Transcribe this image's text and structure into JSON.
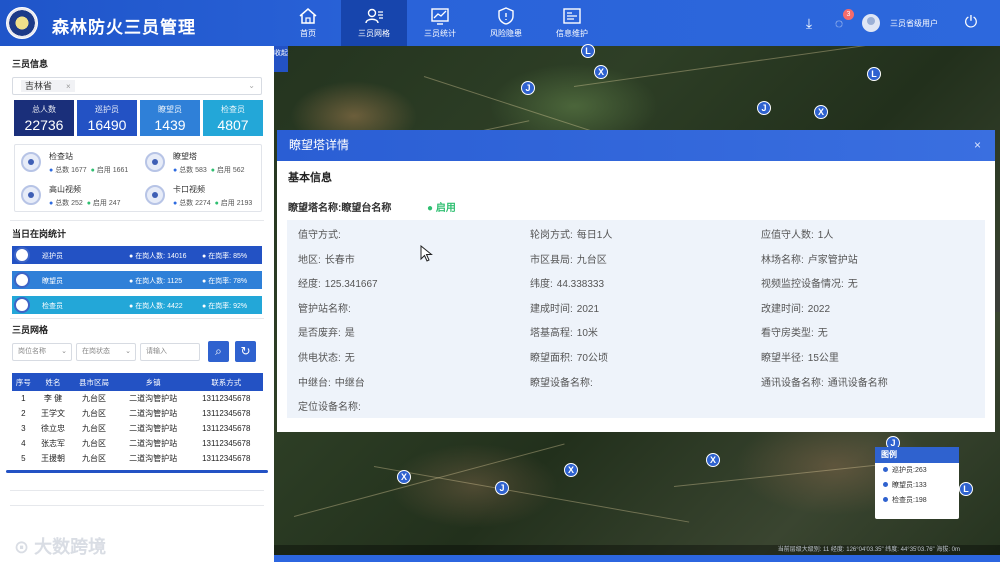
{
  "header": {
    "title": "森林防火三员管理",
    "nav": [
      {
        "label": "首页",
        "icon": "home-icon"
      },
      {
        "label": "三员网格",
        "icon": "users-icon",
        "active": true
      },
      {
        "label": "三员统计",
        "icon": "chart-icon"
      },
      {
        "label": "风险隐患",
        "icon": "shield-icon"
      },
      {
        "label": "信息维护",
        "icon": "id-card-icon"
      }
    ],
    "notification_count": "3",
    "user_name": "三员省级用户"
  },
  "left": {
    "info_title": "三员信息",
    "region_tag": "吉林省",
    "stats": [
      {
        "label": "总人数",
        "value": "22736",
        "color": "#1a2f7a"
      },
      {
        "label": "巡护员",
        "value": "16490",
        "color": "#2352c4"
      },
      {
        "label": "瞭望员",
        "value": "1439",
        "color": "#2f80d8"
      },
      {
        "label": "检查员",
        "value": "4807",
        "color": "#23a7d8"
      }
    ],
    "facilities": [
      {
        "name": "检查站",
        "total": "总数 1677",
        "enabled": "启用 1661"
      },
      {
        "name": "瞭望塔",
        "total": "总数 583",
        "enabled": "启用 562"
      },
      {
        "name": "高山视频",
        "total": "总数 252",
        "enabled": "启用 247"
      },
      {
        "name": "卡口视频",
        "total": "总数 2274",
        "enabled": "启用 2193"
      }
    ],
    "duty_title": "当日在岗统计",
    "duty": [
      {
        "name": "巡护员",
        "count": "在岗人数: 14016",
        "rate": "在岗率: 85%",
        "color": "#2352c4"
      },
      {
        "name": "瞭望员",
        "count": "在岗人数: 1125",
        "rate": "在岗率: 78%",
        "color": "#2f80d8"
      },
      {
        "name": "检查员",
        "count": "在岗人数: 4422",
        "rate": "在岗率: 92%",
        "color": "#23a7d8"
      }
    ],
    "grid_title": "三员网格",
    "filters": {
      "post_placeholder": "岗位名称",
      "status_placeholder": "在岗状态",
      "input_placeholder": "请输入"
    },
    "table": {
      "headers": [
        "序号",
        "姓名",
        "县市区局",
        "乡镇",
        "联系方式"
      ],
      "rows": [
        [
          "1",
          "李 健",
          "九台区",
          "二道沟管护站",
          "13112345678"
        ],
        [
          "2",
          "王学文",
          "九台区",
          "二道沟管护站",
          "13112345678"
        ],
        [
          "3",
          "徐立忠",
          "九台区",
          "二道沟管护站",
          "13112345678"
        ],
        [
          "4",
          "张志军",
          "九台区",
          "二道沟管护站",
          "13112345678"
        ],
        [
          "5",
          "王援朝",
          "九台区",
          "二道沟管护站",
          "13112345678"
        ]
      ]
    },
    "watermark": "大数跨境"
  },
  "map": {
    "collapse_label": "收起",
    "status_text": "当前层级大级别: 11   经度: 126°04'03.35\"  纬度: 44°35'03.76\"  海拔: 0m",
    "legend": {
      "title": "图例",
      "items": [
        "巡护员:263",
        "瞭望员:133",
        "检查员:198"
      ]
    }
  },
  "modal": {
    "title": "瞭望塔详情",
    "section": "基本信息",
    "tower_name": "瞭望塔名称:瞭望台名称",
    "status": "启用",
    "fields": [
      [
        {
          "k": "值守方式:",
          "v": ""
        },
        {
          "k": "轮岗方式:",
          "v": "每日1人"
        },
        {
          "k": "应值守人数:",
          "v": "1人"
        }
      ],
      [
        {
          "k": "地区:",
          "v": "长春市"
        },
        {
          "k": "市区县局:",
          "v": "九台区"
        },
        {
          "k": "林场名称:",
          "v": "卢家管护站"
        }
      ],
      [
        {
          "k": "经度:",
          "v": "125.341667"
        },
        {
          "k": "纬度:",
          "v": "44.338333"
        },
        {
          "k": "视频监控设备情况:",
          "v": "无"
        }
      ],
      [
        {
          "k": "管护站名称:",
          "v": ""
        },
        {
          "k": "建成时间:",
          "v": "2021"
        },
        {
          "k": "改建时间:",
          "v": "2022"
        }
      ],
      [
        {
          "k": "是否废弃:",
          "v": "是"
        },
        {
          "k": "塔基高程:",
          "v": "10米"
        },
        {
          "k": "看守房类型:",
          "v": "无"
        }
      ],
      [
        {
          "k": "供电状态:",
          "v": "无"
        },
        {
          "k": "瞭望面积:",
          "v": "70公顷"
        },
        {
          "k": "瞭望半径:",
          "v": "15公里"
        }
      ],
      [
        {
          "k": "中继台:",
          "v": "中继台"
        },
        {
          "k": "瞭望设备名称:",
          "v": ""
        },
        {
          "k": "通讯设备名称:",
          "v": "通讯设备名称"
        }
      ],
      [
        {
          "k": "定位设备名称:",
          "v": ""
        }
      ]
    ]
  }
}
